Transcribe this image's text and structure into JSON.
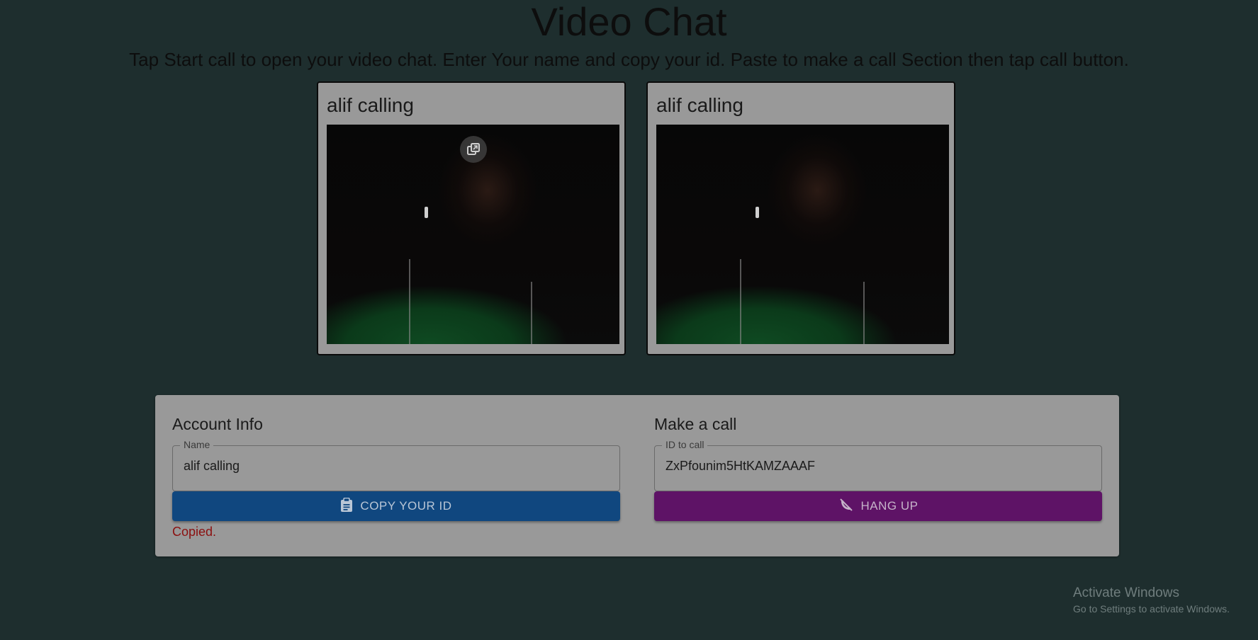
{
  "header": {
    "title": "Video Chat",
    "subtitle": "Tap Start call to open your video chat. Enter Your name and copy your id. Paste to make a call Section then tap call button."
  },
  "videos": [
    {
      "name": "alif calling",
      "pip_icon": "picture-in-picture-icon"
    },
    {
      "name": "alif calling"
    }
  ],
  "account": {
    "title": "Account Info",
    "name_label": "Name",
    "name_value": "alif calling",
    "copy_button_label": "COPY YOUR ID",
    "copy_icon": "clipboard-icon",
    "status": "Copied."
  },
  "call": {
    "title": "Make a call",
    "id_label": "ID to call",
    "id_value": "ZxPfounim5HtKAMZAAAF",
    "hangup_button_label": "HANG UP",
    "hangup_icon": "phone-disabled-icon"
  },
  "watermark": {
    "title": "Activate Windows",
    "subtitle": "Go to Settings to activate Windows."
  },
  "colors": {
    "background": "#1e2e2e",
    "card": "#999999",
    "copy_button": "#10477f",
    "hangup_button": "#5e1366",
    "status_text": "#8b1010"
  }
}
